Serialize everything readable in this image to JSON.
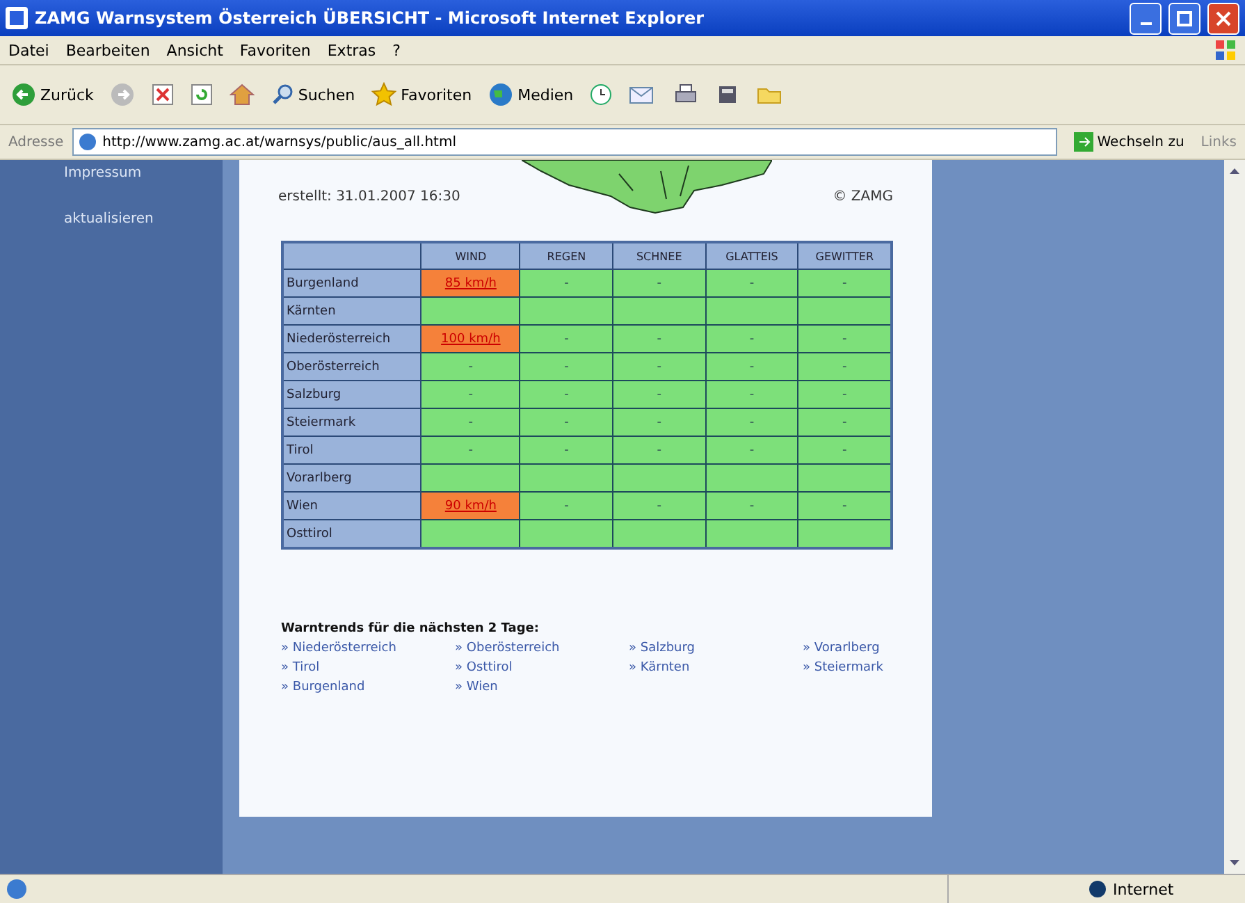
{
  "window": {
    "title": "ZAMG Warnsystem Österreich ÜBERSICHT - Microsoft Internet Explorer"
  },
  "menu": [
    "Datei",
    "Bearbeiten",
    "Ansicht",
    "Favoriten",
    "Extras",
    "?"
  ],
  "toolbar": [
    {
      "kind": "back",
      "label": "Zurück"
    },
    {
      "kind": "forward"
    },
    {
      "kind": "stop"
    },
    {
      "kind": "refresh"
    },
    {
      "kind": "home"
    },
    {
      "kind": "search",
      "label": "Suchen"
    },
    {
      "kind": "favorites",
      "label": "Favoriten"
    },
    {
      "kind": "media",
      "label": "Medien"
    },
    {
      "kind": "history"
    },
    {
      "kind": "mail"
    },
    {
      "kind": "print"
    },
    {
      "kind": "edit"
    },
    {
      "kind": "folder"
    }
  ],
  "address": {
    "label": "Adresse",
    "url": "http://www.zamg.ac.at/warnsys/public/aus_all.html",
    "go": "Wechseln zu",
    "links": "Links"
  },
  "sidebar": {
    "items": [
      "Impressum",
      "aktualisieren"
    ]
  },
  "page": {
    "created": "erstellt: 31.01.2007 16:30",
    "copyright": "© ZAMG",
    "table": {
      "columns": [
        "WIND",
        "REGEN",
        "SCHNEE",
        "GLATTEIS",
        "GEWITTER"
      ],
      "rows": [
        {
          "region": "Burgenland",
          "cells": [
            {
              "text": "85 km/h",
              "warning": true
            },
            {
              "text": "-",
              "warning": false
            },
            {
              "text": "-",
              "warning": false
            },
            {
              "text": "-",
              "warning": false
            },
            {
              "text": "-",
              "warning": false
            }
          ]
        },
        {
          "region": "Kärnten",
          "cells": [
            {
              "warning": false
            },
            {
              "warning": false
            },
            {
              "warning": false
            },
            {
              "warning": false
            },
            {
              "warning": false
            }
          ]
        },
        {
          "region": "Niederösterreich",
          "cells": [
            {
              "text": "100 km/h",
              "warning": true
            },
            {
              "text": "-",
              "warning": false
            },
            {
              "text": "-",
              "warning": false
            },
            {
              "text": "-",
              "warning": false
            },
            {
              "text": "-",
              "warning": false
            }
          ]
        },
        {
          "region": "Oberösterreich",
          "cells": [
            {
              "text": "-",
              "warning": false
            },
            {
              "text": "-",
              "warning": false
            },
            {
              "text": "-",
              "warning": false
            },
            {
              "text": "-",
              "warning": false
            },
            {
              "text": "-",
              "warning": false
            }
          ]
        },
        {
          "region": "Salzburg",
          "cells": [
            {
              "text": "-",
              "warning": false
            },
            {
              "text": "-",
              "warning": false
            },
            {
              "text": "-",
              "warning": false
            },
            {
              "text": "-",
              "warning": false
            },
            {
              "text": "-",
              "warning": false
            }
          ]
        },
        {
          "region": "Steiermark",
          "cells": [
            {
              "text": "-",
              "warning": false
            },
            {
              "text": "-",
              "warning": false
            },
            {
              "text": "-",
              "warning": false
            },
            {
              "text": "-",
              "warning": false
            },
            {
              "text": "-",
              "warning": false
            }
          ]
        },
        {
          "region": "Tirol",
          "cells": [
            {
              "text": "-",
              "warning": false
            },
            {
              "text": "-",
              "warning": false
            },
            {
              "text": "-",
              "warning": false
            },
            {
              "text": "-",
              "warning": false
            },
            {
              "text": "-",
              "warning": false
            }
          ]
        },
        {
          "region": "Vorarlberg",
          "cells": [
            {
              "warning": false
            },
            {
              "warning": false
            },
            {
              "warning": false
            },
            {
              "warning": false
            },
            {
              "warning": false
            }
          ]
        },
        {
          "region": "Wien",
          "cells": [
            {
              "text": "90 km/h",
              "warning": true
            },
            {
              "text": "-",
              "warning": false
            },
            {
              "text": "-",
              "warning": false
            },
            {
              "text": "-",
              "warning": false
            },
            {
              "text": "-",
              "warning": false
            }
          ]
        },
        {
          "region": "Osttirol",
          "cells": [
            {
              "warning": false
            },
            {
              "warning": false
            },
            {
              "warning": false
            },
            {
              "warning": false
            },
            {
              "warning": false
            }
          ]
        }
      ]
    },
    "trends": {
      "heading": "Warntrends für die nächsten 2 Tage:",
      "bullet": "»",
      "links": [
        "Niederösterreich",
        "Oberösterreich",
        "Salzburg",
        "Vorarlberg",
        "Tirol",
        "Osttirol",
        "Kärnten",
        "Steiermark",
        "Burgenland",
        "Wien"
      ]
    }
  },
  "status_bar": {
    "zone": "Internet"
  }
}
